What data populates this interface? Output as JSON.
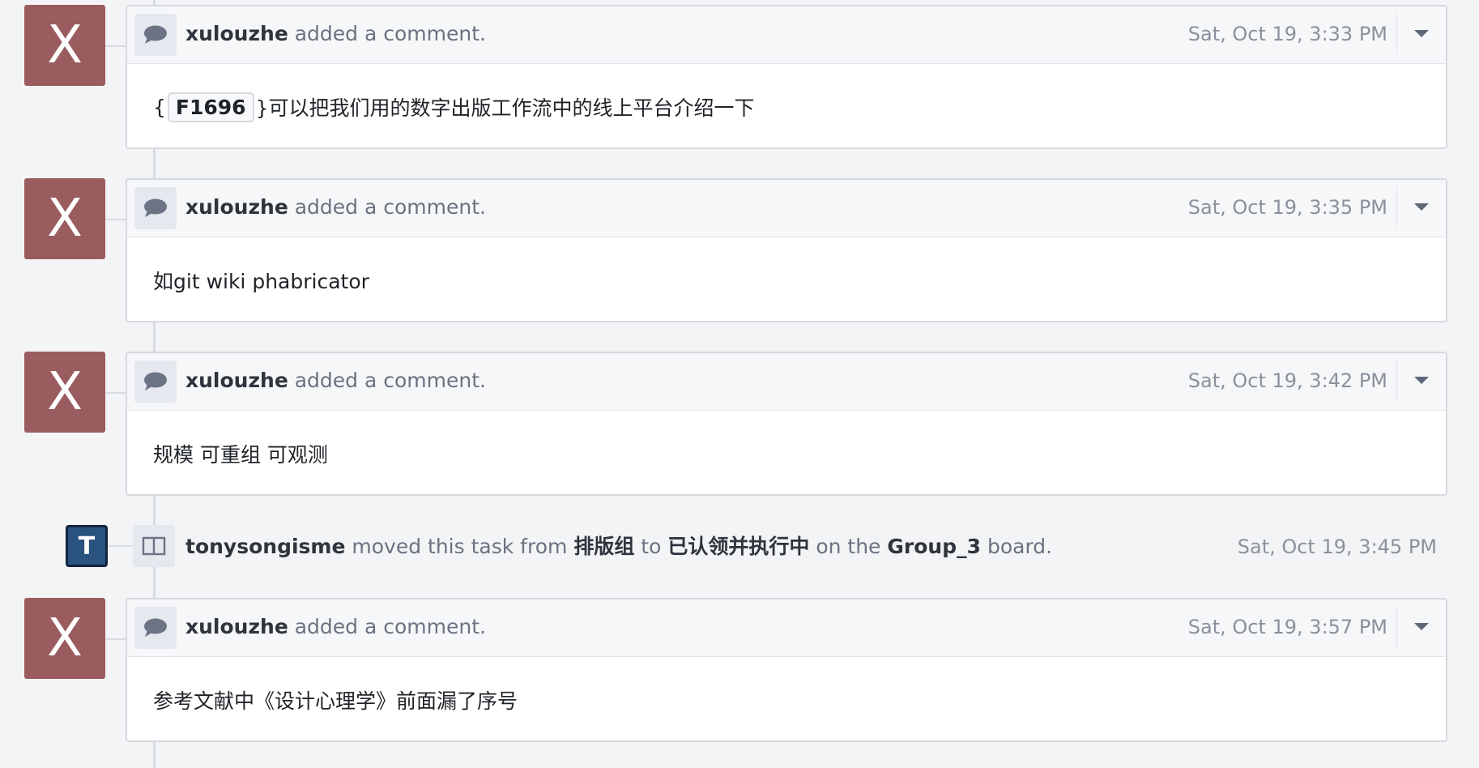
{
  "timeline": {
    "comments": [
      {
        "avatar_letter": "X",
        "author": "xulouzhe",
        "action": "added a comment.",
        "timestamp": "Sat, Oct 19, 3:33 PM",
        "body_prefix": "{",
        "file_ref": "F1696",
        "body": "}可以把我们用的数字出版工作流中的线上平台介绍一下"
      },
      {
        "avatar_letter": "X",
        "author": "xulouzhe",
        "action": "added a comment.",
        "timestamp": "Sat, Oct 19, 3:35 PM",
        "body": "如git wiki phabricator"
      },
      {
        "avatar_letter": "X",
        "author": "xulouzhe",
        "action": "added a comment.",
        "timestamp": "Sat, Oct 19, 3:42 PM",
        "body": "规模 可重组 可观测"
      },
      {
        "avatar_letter": "X",
        "author": "xulouzhe",
        "action": "added a comment.",
        "timestamp": "Sat, Oct 19, 3:57 PM",
        "body": "参考文献中《设计心理学》前面漏了序号"
      }
    ],
    "move_event": {
      "avatar_letter": "T",
      "author": "tonysongisme",
      "text_moved": "moved this task from",
      "from_column": "排版组",
      "text_to": "to",
      "to_column": "已认领并执行中",
      "text_on_the": "on the",
      "board_name": "Group_3",
      "text_board": "board.",
      "timestamp": "Sat, Oct 19, 3:45 PM"
    }
  },
  "icons": {
    "comment": "speech-bubble-icon",
    "board": "columns-icon",
    "menu": "caret-down-icon"
  },
  "colors": {
    "avatar_x": "#9a5c5e",
    "avatar_t": "#29527e",
    "background": "#f3f4f6"
  }
}
